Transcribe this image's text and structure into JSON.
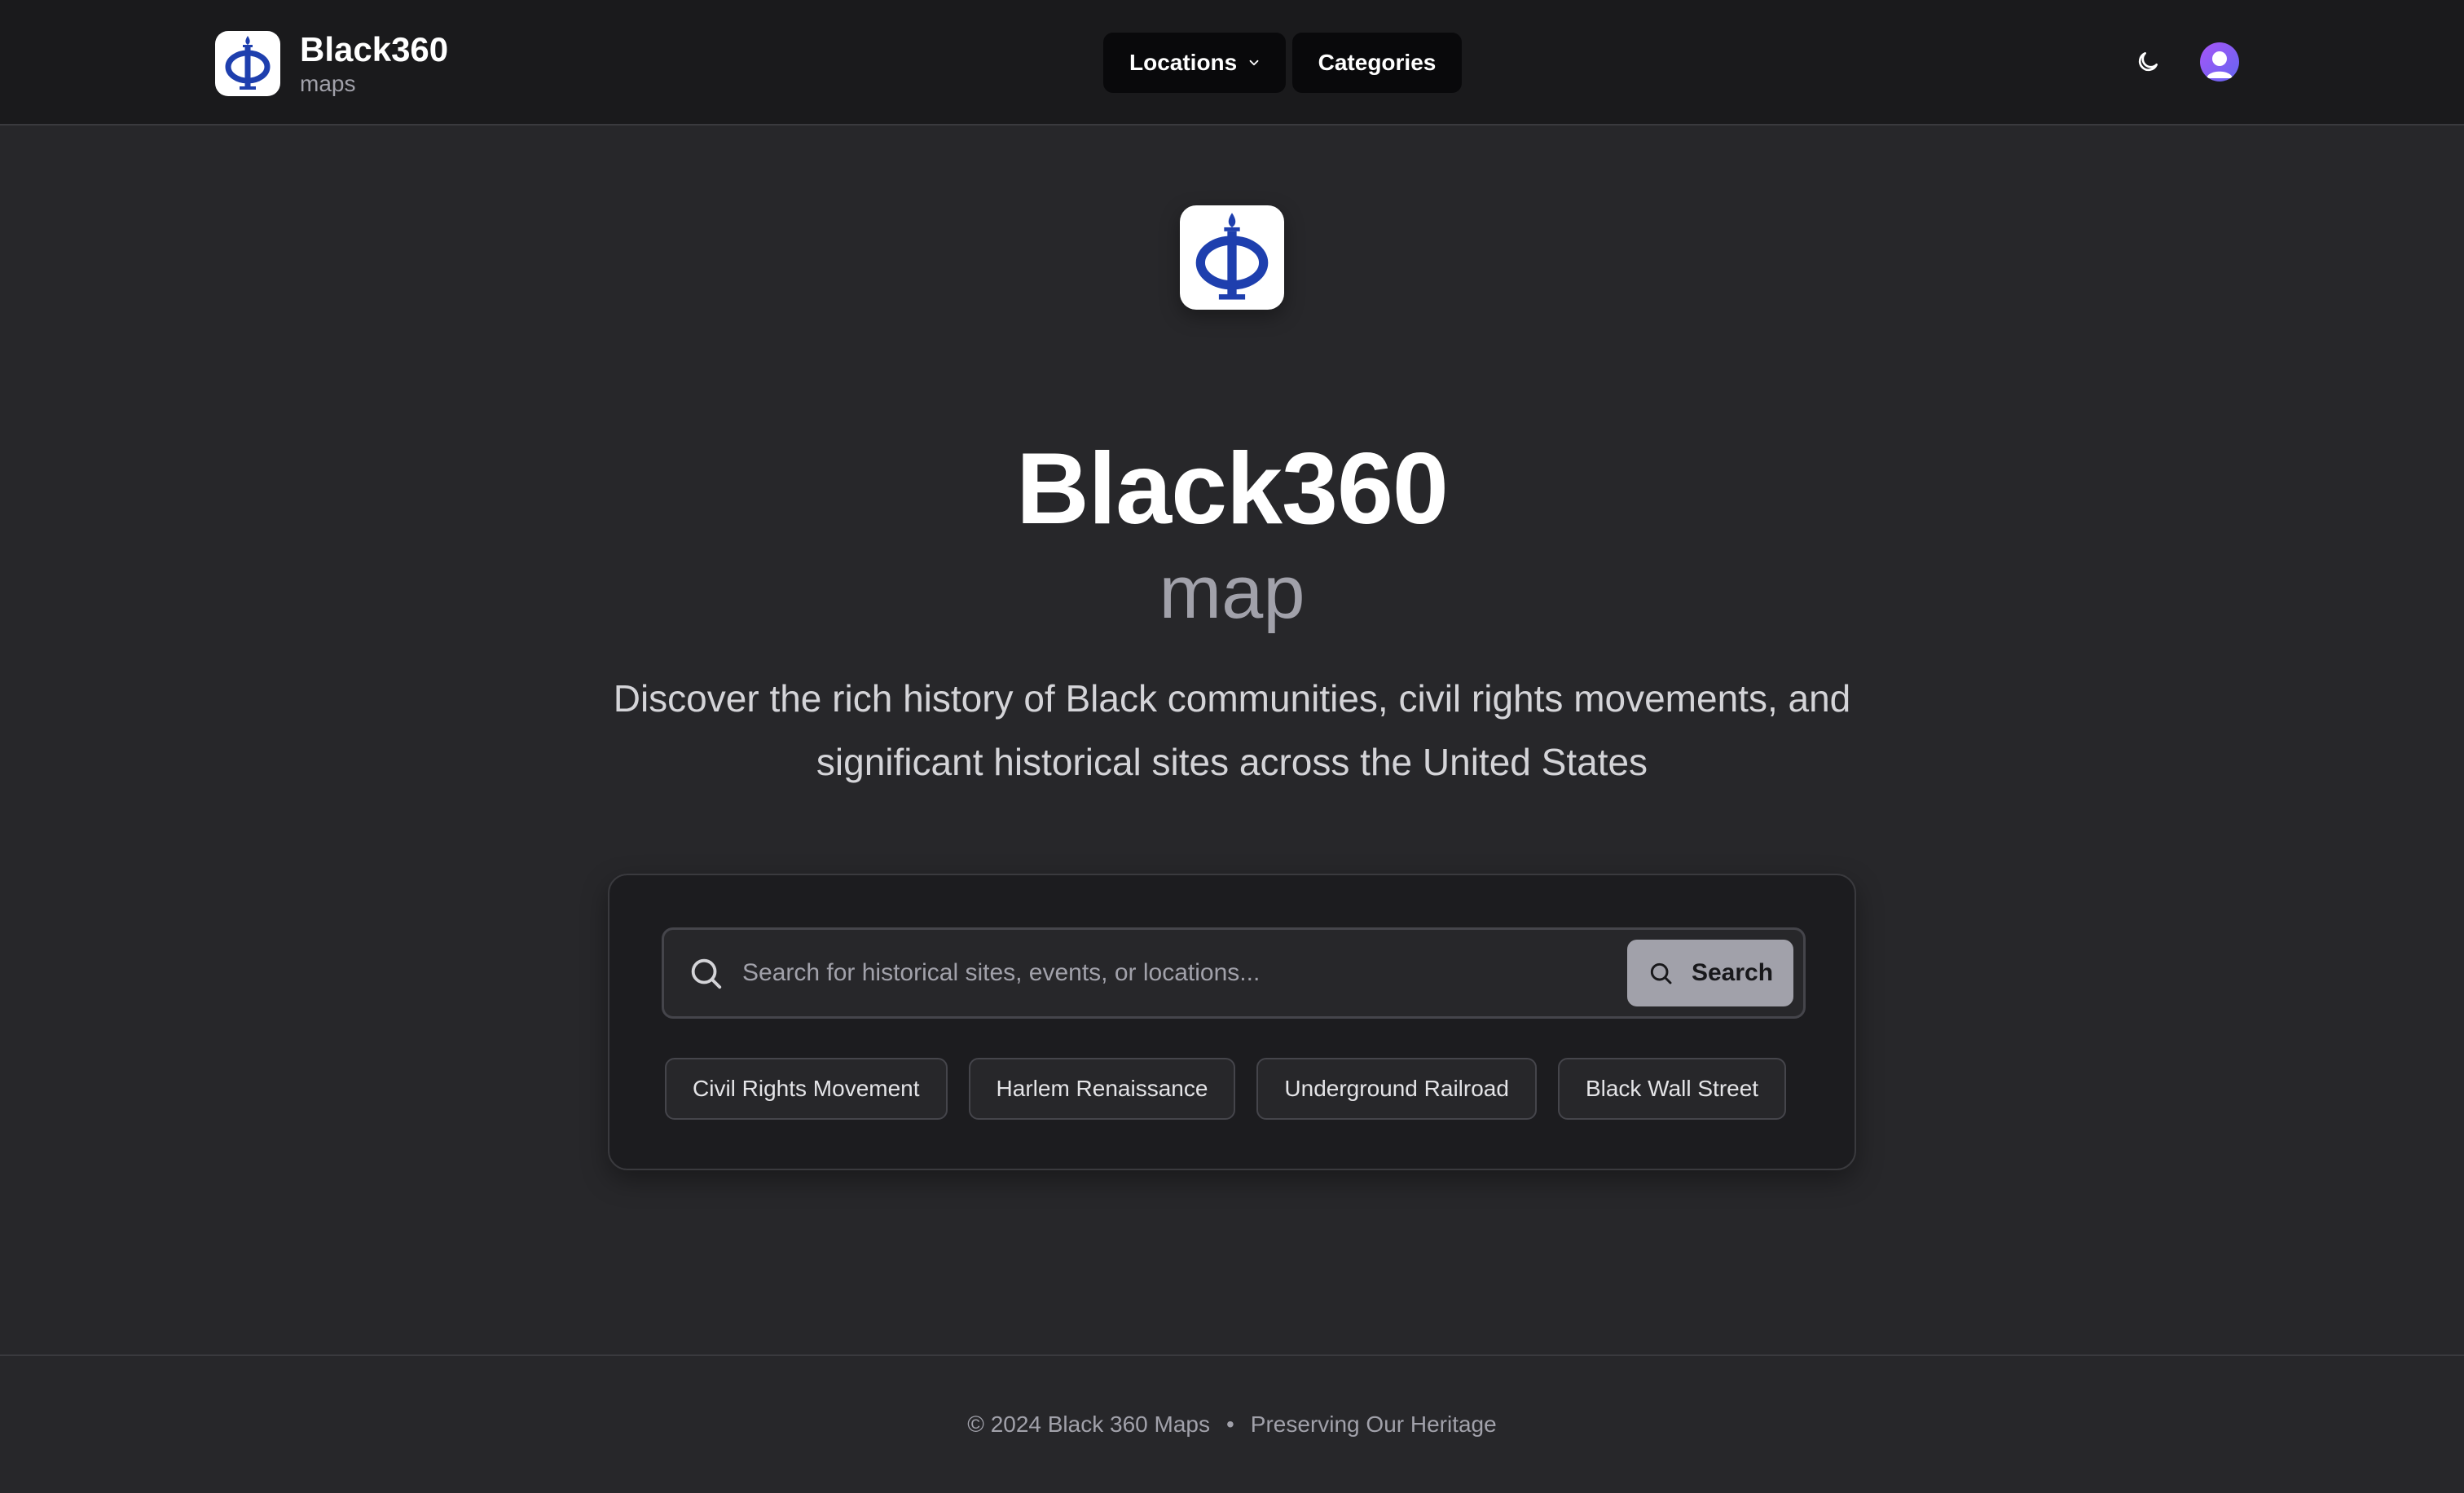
{
  "header": {
    "brand_title": "Black360",
    "brand_subtitle": "maps",
    "nav": {
      "locations_label": "Locations",
      "categories_label": "Categories"
    },
    "theme_toggle_icon": "moon-icon",
    "avatar_icon": "user-avatar-icon"
  },
  "hero": {
    "logo_icon": "phi-torch-logo",
    "title": "Black360",
    "subtitle": "map",
    "description": "Discover the rich history of Black communities, civil rights movements, and significant historical sites across the United States"
  },
  "search": {
    "placeholder": "Search for historical sites, events, or locations...",
    "value": "",
    "button_label": "Search",
    "chips": [
      "Civil Rights Movement",
      "Harlem Renaissance",
      "Underground Railroad",
      "Black Wall Street"
    ]
  },
  "footer": {
    "copyright": "© 2024 Black 360 Maps",
    "separator": "•",
    "tagline": "Preserving Our Heritage"
  },
  "colors": {
    "background": "#27272a",
    "header_bg": "#1a1a1c",
    "logo_blue": "#1e3fae",
    "avatar_gradient_start": "#a855f7",
    "avatar_gradient_end": "#6366f1"
  }
}
